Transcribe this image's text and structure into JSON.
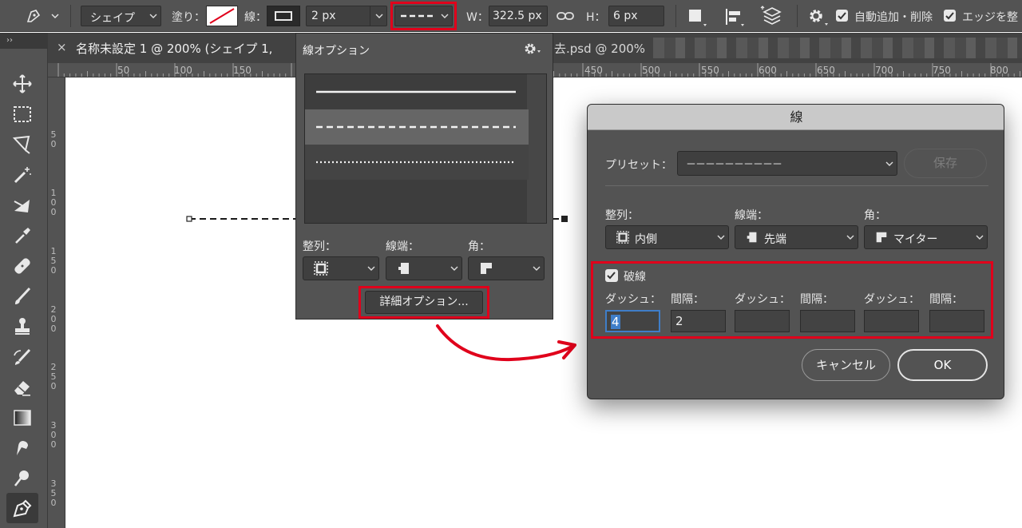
{
  "optbar": {
    "mode": "シェイプ",
    "fill_label": "塗り：",
    "stroke_label": "線：",
    "stroke_width": "2 px",
    "w_label": "W：",
    "w_value": "322.5 px",
    "h_label": "H：",
    "h_value": "6 px",
    "auto_add_delete": "自動追加・削除",
    "align_edges": "エッジを整"
  },
  "tabbar": {
    "collapse": "››",
    "close": "×",
    "tab1": "名称未設定 1 @ 200% (シェイプ 1,",
    "tab2": "去.psd @ 200%"
  },
  "ruler_top": [
    "50",
    "100",
    "150",
    "450",
    "500",
    "550",
    "600",
    "650",
    "700",
    "750",
    "800"
  ],
  "ruler_left": [
    [
      "5",
      "0"
    ],
    [
      "1",
      "0",
      "0"
    ],
    [
      "1",
      "5",
      "0"
    ],
    [
      "2",
      "0",
      "0"
    ],
    [
      "2",
      "5",
      "0"
    ],
    [
      "3",
      "0",
      "0"
    ],
    [
      "3",
      "5",
      "0"
    ]
  ],
  "popup": {
    "title": "線オプション",
    "align_label": "整列：",
    "cap_label": "線端：",
    "corner_label": "角：",
    "more_options": "詳細オプション..."
  },
  "dialog": {
    "title": "線",
    "preset_label": "プリセット：",
    "preset_value": "－－－－－－－－－－",
    "save": "保存",
    "align_label": "整列：",
    "align_value": "内側",
    "cap_label": "線端：",
    "cap_value": "先端",
    "corner_label": "角：",
    "corner_value": "マイター",
    "dashed_label": "破線",
    "dash_label": "ダッシュ：",
    "gap_label": "間隔：",
    "dash1": "4",
    "gap1": "2",
    "dash2": "",
    "gap2": "",
    "dash3": "",
    "gap3": "",
    "cancel": "キャンセル",
    "ok": "OK"
  },
  "colors": {
    "highlight": "#e0001b",
    "panel": "#535353",
    "annotation_arrow": "#e0001b"
  }
}
